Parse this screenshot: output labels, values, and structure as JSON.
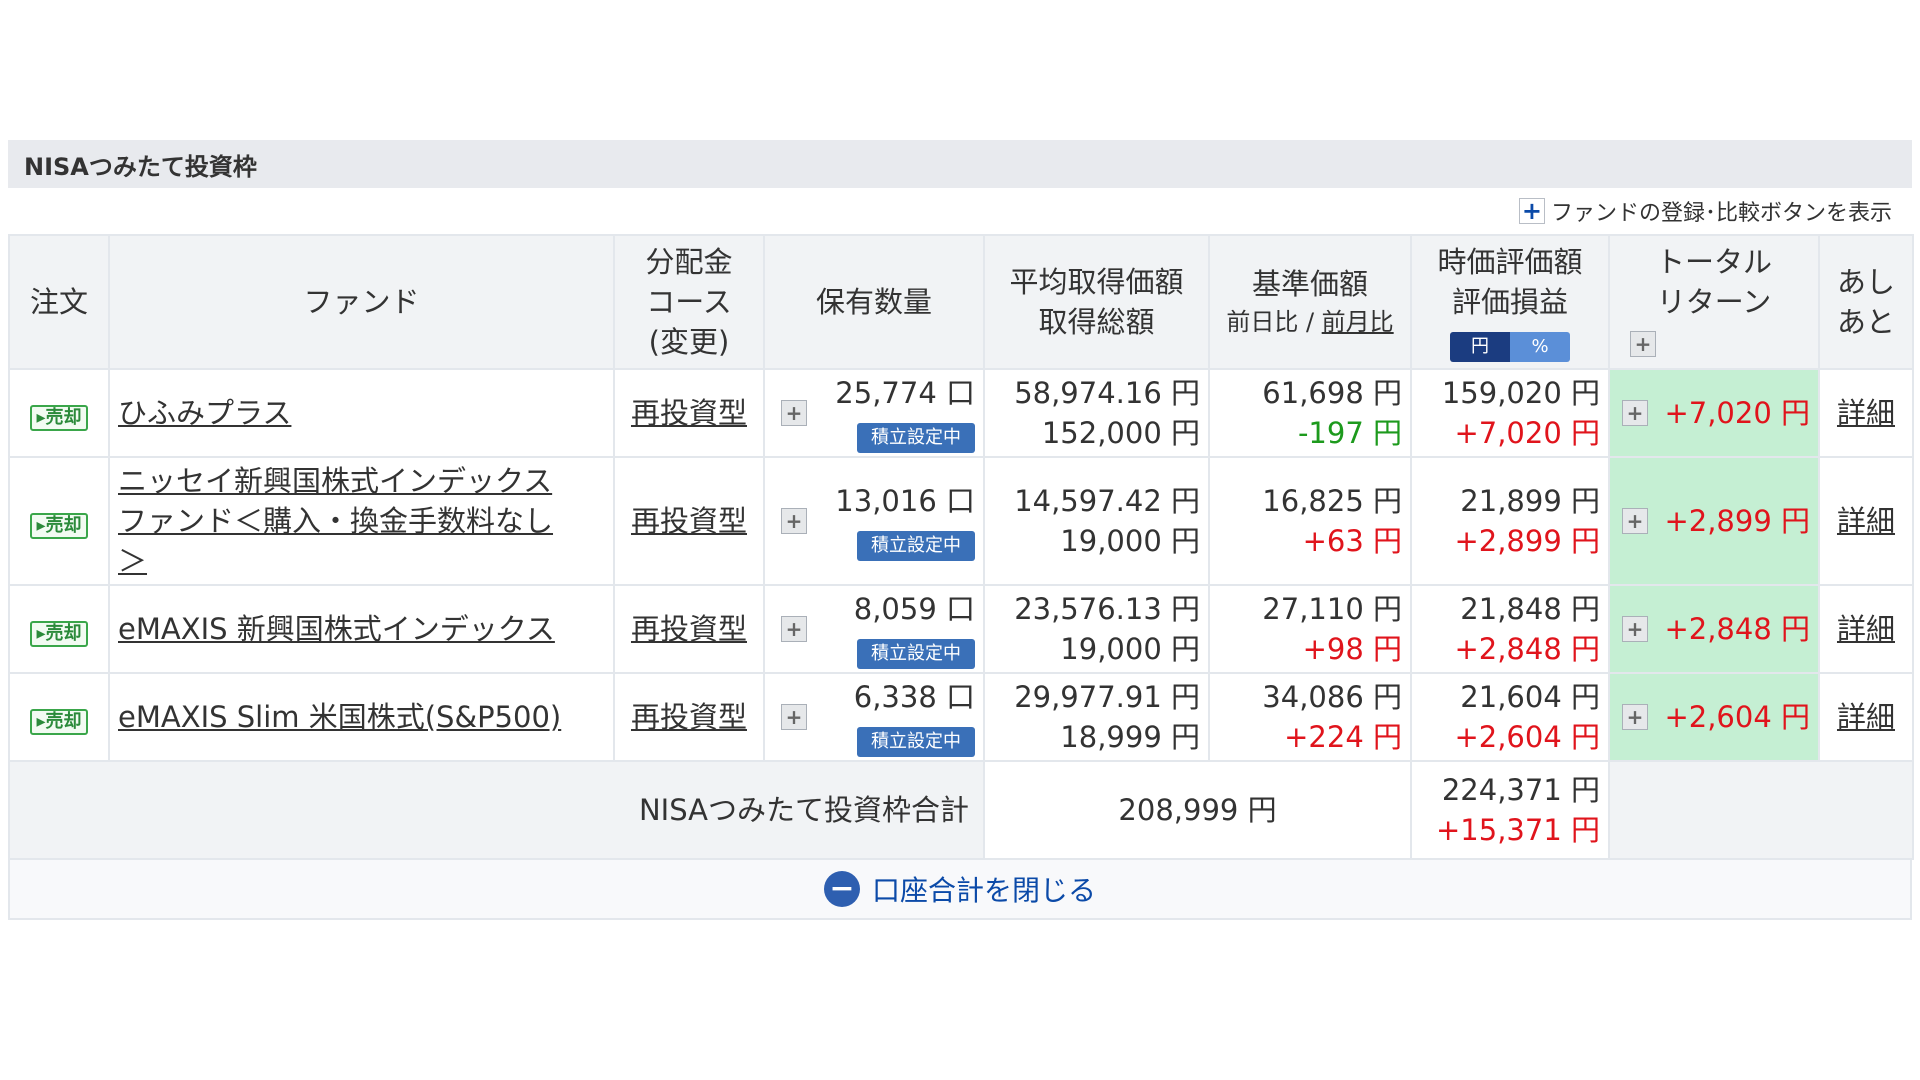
{
  "section_title": "NISAつみたて投資枠",
  "toolbar": {
    "toggle_label": "ファンドの登録･比較ボタンを表示"
  },
  "columns": {
    "order": "注文",
    "fund": "ファンド",
    "course_l1": "分配金",
    "course_l2": "コース",
    "course_l3": "(変更)",
    "qty": "保有数量",
    "avg_l1": "平均取得価額",
    "avg_l2": "取得総額",
    "nav_l1": "基準価額",
    "nav_sub_day": "前日比",
    "nav_sub_sep": " / ",
    "nav_sub_month": "前月比",
    "mkt_l1": "時価評価額",
    "mkt_l2": "評価損益",
    "toggle_yen": "円",
    "toggle_pct": "%",
    "total_l1": "トータル",
    "total_l2": "リターン",
    "hist_l1": "あし",
    "hist_l2": "あと"
  },
  "sell_label": "売却",
  "setting_label": "積立設定中",
  "detail_label": "詳細",
  "rows": [
    {
      "fund": [
        "ひふみプラス"
      ],
      "course": "再投資型",
      "qty": "25,774 口",
      "avg_price": "58,974.16 円",
      "total_cost": "152,000 円",
      "nav": "61,698 円",
      "nav_change": "-197 円",
      "market_value": "159,020 円",
      "unrealized": "+7,020 円",
      "total_return": "+7,020 円"
    },
    {
      "fund": [
        "ニッセイ新興国株式インデックス",
        "ファンド＜購入・換金手数料なし",
        "＞"
      ],
      "course": "再投資型",
      "qty": "13,016 口",
      "avg_price": "14,597.42 円",
      "total_cost": "19,000 円",
      "nav": "16,825 円",
      "nav_change": "+63 円",
      "market_value": "21,899 円",
      "unrealized": "+2,899 円",
      "total_return": "+2,899 円"
    },
    {
      "fund": [
        "eMAXIS 新興国株式インデックス"
      ],
      "course": "再投資型",
      "qty": "8,059 口",
      "avg_price": "23,576.13 円",
      "total_cost": "19,000 円",
      "nav": "27,110 円",
      "nav_change": "+98 円",
      "market_value": "21,848 円",
      "unrealized": "+2,848 円",
      "total_return": "+2,848 円"
    },
    {
      "fund": [
        "eMAXIS Slim 米国株式(S&P500)"
      ],
      "course": "再投資型",
      "qty": "6,338 口",
      "avg_price": "29,977.91 円",
      "total_cost": "18,999 円",
      "nav": "34,086 円",
      "nav_change": "+224 円",
      "market_value": "21,604 円",
      "unrealized": "+2,604 円",
      "total_return": "+2,604 円"
    }
  ],
  "totals": {
    "label": "NISAつみたて投資枠合計",
    "total_cost": "208,999 円",
    "market_value": "224,371 円",
    "unrealized": "+15,371 円"
  },
  "footer": {
    "close_label": "口座合計を閉じる"
  },
  "colors": {
    "positive": "#e0141c",
    "negative": "#1d9a1d",
    "accent": "#0b4aa8",
    "highlight": "#c5efd3"
  }
}
